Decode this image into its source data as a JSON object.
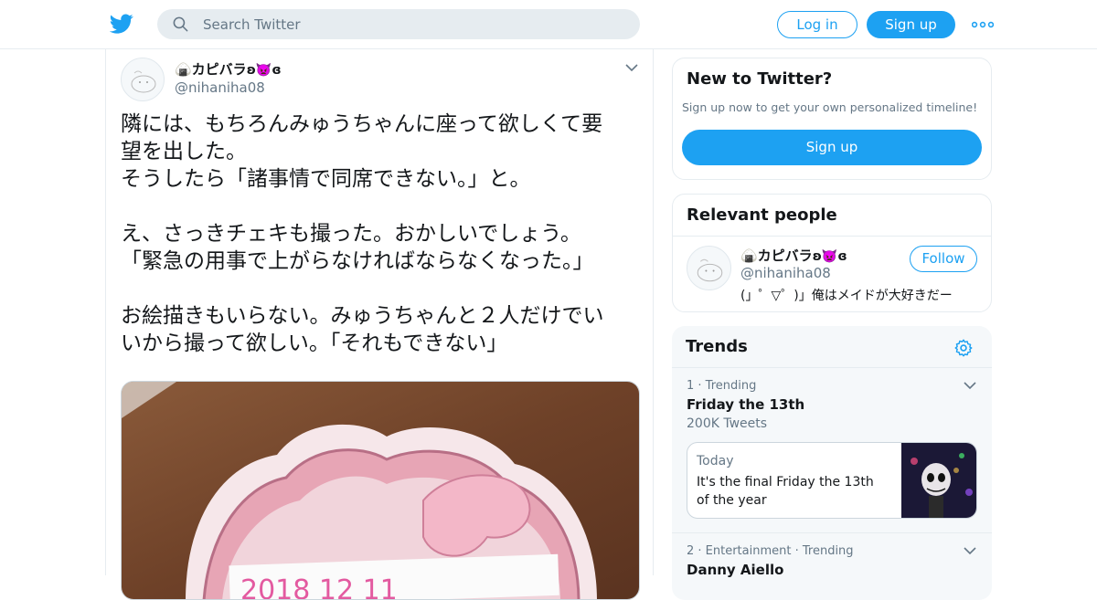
{
  "header": {
    "search_placeholder": "Search Twitter",
    "login_label": "Log in",
    "signup_label": "Sign up"
  },
  "tweet": {
    "display_name": "🍙カピバラ",
    "display_name_suffix": "ʚ👿ɞ",
    "handle": "@nihaniha08",
    "text": "隣には、もちろんみゅうちゃんに座って欲しくて要\n望を出した。\nそうしたら「諸事情で同席できない。」と。\n\nえ、さっきチェキも撮った。おかしいでしょう。\n「緊急の用事で上がらなければならなくなった。」\n\nお絵描きもいらない。みゅうちゃんと２人だけでい\nいから撮って欲しい。「それもできない」"
  },
  "sidebar": {
    "new_card": {
      "title": "New to Twitter?",
      "subtitle": "Sign up now to get your own personalized timeline!",
      "signup_label": "Sign up"
    },
    "relevant": {
      "title": "Relevant people",
      "person": {
        "name": "🍙カピバラ",
        "name_suffix": "ʚ👿ɞ",
        "handle": "@nihaniha08",
        "follow_label": "Follow",
        "bio": "(」゜▽゜)」俺はメイドが大好きだー"
      }
    },
    "trends": {
      "title": "Trends",
      "items": [
        {
          "meta": "1 · Trending",
          "name": "Friday the 13th",
          "count": "200K Tweets",
          "news": {
            "time": "Today",
            "description": "It's the final Friday the 13th of the year"
          }
        },
        {
          "meta": "2 · Entertainment · Trending",
          "name": "Danny Aiello"
        }
      ]
    }
  },
  "colors": {
    "brand": "#1da1f2",
    "text": "#14171a",
    "muted": "#657786",
    "border": "#e6ecf0"
  },
  "icons": [
    "twitter-bird-icon",
    "search-icon",
    "more-icon",
    "chevron-down-icon",
    "gear-icon"
  ]
}
